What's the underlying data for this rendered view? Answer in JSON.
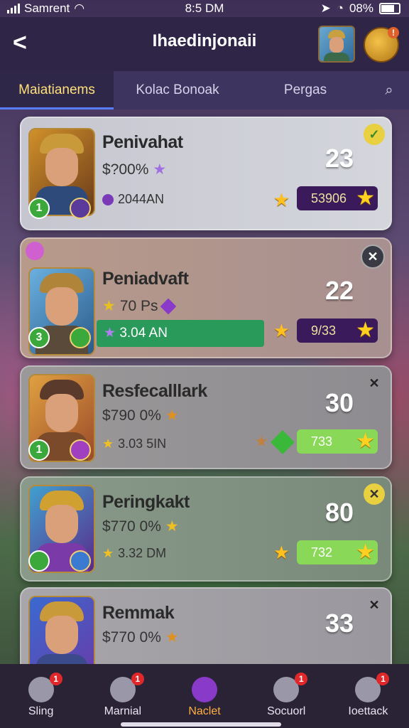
{
  "status": {
    "carrier": "Samrent",
    "time": "8:5 DM",
    "battery": "08%"
  },
  "header": {
    "title": "Ihaedinjonaii",
    "coin_badge": "!"
  },
  "tabs": [
    {
      "label": "Maiatianems",
      "active": true
    },
    {
      "label": "Kolac Bonoak",
      "active": false
    },
    {
      "label": "Pergas",
      "active": false
    }
  ],
  "cards": [
    {
      "name": "Penivahat",
      "pct": "$?00%",
      "sub": "2044AN",
      "level": "1",
      "score": "23",
      "bar_value": "53906"
    },
    {
      "name": "Peniadvaft",
      "pct": "70 Ps",
      "sub": "3.04 AN",
      "level": "3",
      "score": "22",
      "bar_value": "9/33"
    },
    {
      "name": "Resfecalllark",
      "pct": "$790 0%",
      "sub": "3.03 5IN",
      "level": "1",
      "score": "30",
      "bar_value": "733"
    },
    {
      "name": "Peringkakt",
      "pct": "$770 0%",
      "sub": "3.32 DM",
      "level": "",
      "score": "80",
      "bar_value": "732"
    },
    {
      "name": "Remmak",
      "pct": "$770 0%",
      "sub": "",
      "level": "",
      "score": "33",
      "bar_value": ""
    }
  ],
  "nav": [
    {
      "label": "Sling",
      "badge": "1"
    },
    {
      "label": "Marnial",
      "badge": "1"
    },
    {
      "label": "Naclet",
      "badge": ""
    },
    {
      "label": "Socuorl",
      "badge": "1"
    },
    {
      "label": "Ioettack",
      "badge": "1"
    }
  ]
}
